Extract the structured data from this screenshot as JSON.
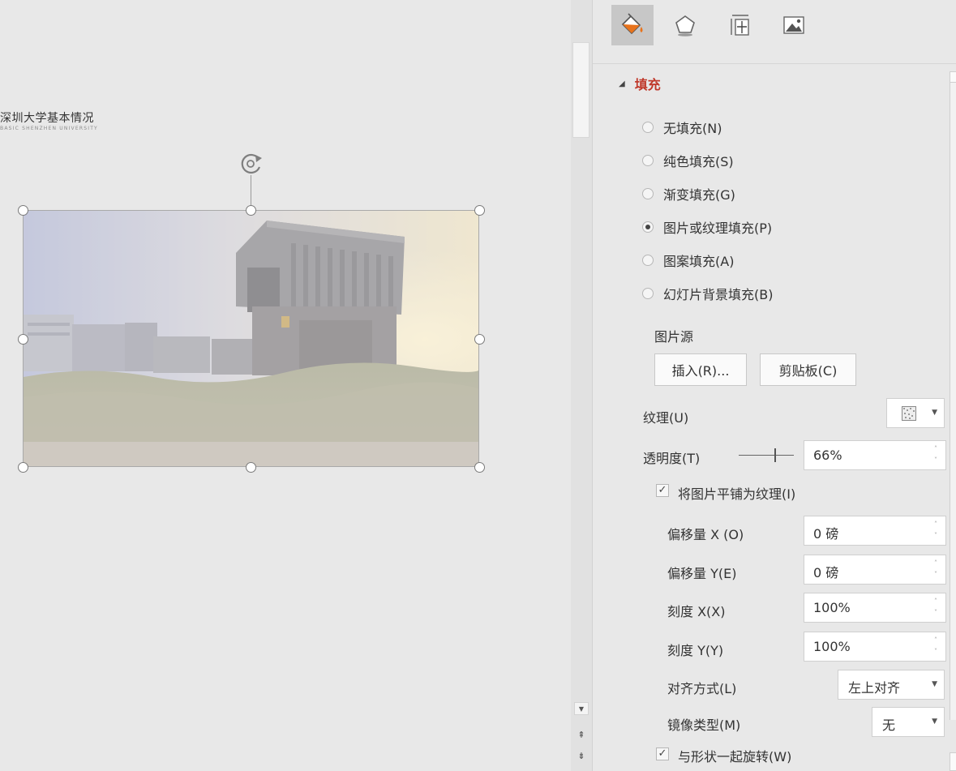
{
  "slide": {
    "title": "深圳大学基本情况",
    "subtitle": "BASIC SHENZHEN UNIVERSITY"
  },
  "scrollbar": {
    "scroll_down_icon": "triangle-down-icon",
    "prev_slide_icon": "double-chevron-up-icon",
    "next_slide_icon": "double-chevron-down-icon",
    "scroll_down_glyph": "▼",
    "prev_slide_glyph": "⇞",
    "next_slide_glyph": "⇟"
  },
  "pane": {
    "tabs": [
      {
        "name": "fill-line",
        "icon": "paint-bucket-icon",
        "active": true
      },
      {
        "name": "effects",
        "icon": "pentagon-icon",
        "active": false
      },
      {
        "name": "size-properties",
        "icon": "size-properties-icon",
        "active": false
      },
      {
        "name": "picture",
        "icon": "picture-icon",
        "active": false
      }
    ],
    "section_arrow": "◢",
    "section_title": "填充",
    "fill_options": [
      {
        "label": "无填充(N)",
        "checked": false
      },
      {
        "label": "纯色填充(S)",
        "checked": false
      },
      {
        "label": "渐变填充(G)",
        "checked": false
      },
      {
        "label": "图片或纹理填充(P)",
        "checked": true
      },
      {
        "label": "图案填充(A)",
        "checked": false
      },
      {
        "label": "幻灯片背景填充(B)",
        "checked": false
      }
    ],
    "picture_source_label": "图片源",
    "insert_button": "插入(R)...",
    "clipboard_button": "剪贴板(C)",
    "texture_label": "纹理(U)",
    "transparency_label": "透明度(T)",
    "transparency_value": "66%",
    "transparency_level": 0.66,
    "tile_checkbox_label": "将图片平铺为纹理(I)",
    "tile_checked": true,
    "check_glyph": "✓",
    "offset_x_label": "偏移量 X (O)",
    "offset_x_value": "0 磅",
    "offset_y_label": "偏移量 Y(E)",
    "offset_y_value": "0 磅",
    "scale_x_label": "刻度 X(X)",
    "scale_x_value": "100%",
    "scale_y_label": "刻度 Y(Y)",
    "scale_y_value": "100%",
    "alignment_label": "对齐方式(L)",
    "alignment_value": "左上对齐",
    "mirror_label": "镜像类型(M)",
    "mirror_value": "无",
    "rotate_checkbox_label": "与形状一起旋转(W)",
    "rotate_checked": true,
    "spin_up": "˄",
    "spin_down": "˅",
    "dropdown_arrow": "▼"
  },
  "colors": {
    "section_title": "#c0392b",
    "active_tab": "#c7c7c7",
    "bucket_orange": "#e8731c"
  }
}
